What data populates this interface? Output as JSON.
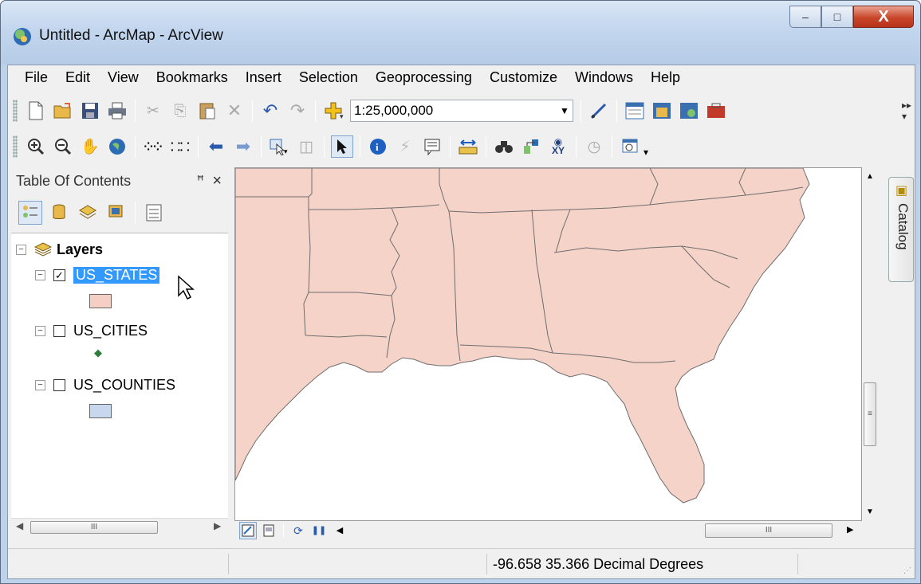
{
  "window": {
    "title": "Untitled - ArcMap - ArcView",
    "minimize_glyph": "–",
    "maximize_glyph": "□",
    "close_glyph": "X"
  },
  "menu": [
    "File",
    "Edit",
    "View",
    "Bookmarks",
    "Insert",
    "Selection",
    "Geoprocessing",
    "Customize",
    "Windows",
    "Help"
  ],
  "toolbar": {
    "scale_value": "1:25,000,000",
    "icons_row1": [
      "new-document-icon",
      "open-folder-icon",
      "save-icon",
      "print-icon",
      "cut-icon",
      "copy-icon",
      "paste-icon",
      "delete-icon",
      "undo-icon",
      "redo-icon",
      "add-data-icon",
      "scale-dropdown",
      "editor-toolbar-icon",
      "table-of-contents-icon",
      "catalog-window-icon",
      "search-window-icon",
      "arctoolbox-icon"
    ],
    "icons_row2": [
      "zoom-in-icon",
      "zoom-out-icon",
      "pan-icon",
      "full-extent-icon",
      "fixed-zoom-in-icon",
      "fixed-zoom-out-icon",
      "go-back-icon",
      "go-forward-icon",
      "select-features-icon",
      "clear-selection-icon",
      "select-elements-icon",
      "identify-icon",
      "hyperlink-icon",
      "html-popup-icon",
      "measure-icon",
      "find-icon",
      "find-route-icon",
      "go-to-xy-icon",
      "time-slider-icon",
      "create-viewer-icon"
    ]
  },
  "toc": {
    "title": "Table Of Contents",
    "pin_glyph": "ᵖ",
    "close_glyph": "×",
    "root_label": "Layers",
    "layers": [
      {
        "name": "US_STATES",
        "checked": true,
        "selected": true,
        "symbol_color": "#f5cfc4",
        "symbol": "polygon"
      },
      {
        "name": "US_CITIES",
        "checked": false,
        "selected": false,
        "symbol_color": "#2f7d3a",
        "symbol": "point"
      },
      {
        "name": "US_COUNTIES",
        "checked": false,
        "selected": false,
        "symbol_color": "#c8d6ee",
        "symbol": "polygon"
      }
    ],
    "scroll_thumb_glyph": "III"
  },
  "map": {
    "fill_color": "#f5d3c9",
    "outline_color": "#6e6e6e",
    "scroll_thumb_glyph": "III",
    "vscroll_thumb_glyph": "≡"
  },
  "catalog": {
    "label": "Catalog"
  },
  "status": {
    "coordinates": "-96.658  35.366 Decimal Degrees"
  }
}
